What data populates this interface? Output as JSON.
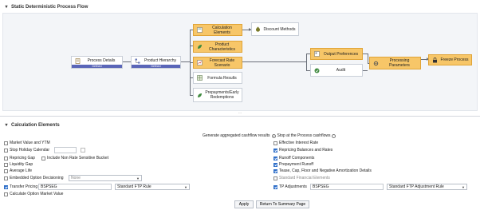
{
  "flow_section": {
    "title": "Static Deterministic Process Flow",
    "nodes": {
      "process_details": {
        "label": "Process Details",
        "status": "Defined"
      },
      "product_hierarchy": {
        "label": "Product Hierarchy",
        "status": "Defined"
      },
      "calculation_elements": {
        "label": "Calculation Elements"
      },
      "discount_methods": {
        "label": "Discount Methods"
      },
      "product_characteristics": {
        "label": "Product Characteristics"
      },
      "forecast_rate_scenario": {
        "label": "Forecast Rate Scenario"
      },
      "formula_results": {
        "label": "Formula Results"
      },
      "prepayments": {
        "label": "Prepayments/Early Redemptions"
      },
      "output_preferences": {
        "label": "Output Preferences"
      },
      "audit": {
        "label": "Audit"
      },
      "processing_parameters": {
        "label": "Processing Parameters"
      },
      "freeze_process": {
        "label": "Freeze Process"
      }
    }
  },
  "calc_section": {
    "title": "Calculation Elements",
    "cashflow_label": "Generate aggregated cashflow results",
    "stop_at_flows": "Stop at the Process cashflows",
    "left": {
      "market_value": "Market Value and YTM",
      "stop_holiday": "Stop Holiday Calendar",
      "repricing_gap": "Repricing Gap",
      "non_rate": "Include Non Rate Sensitive Bucket",
      "liquidity_gap": "Liquidity Gap",
      "average_life": "Average Life",
      "embedded_option": "Embedded Option Decisioning",
      "embedded_value": "None",
      "transfer_pricing": "Transfer Pricing",
      "tp_code": "BSPSEG",
      "tp_rule": "Standard FTP Rule",
      "calc_option": "Calculate Option Market Value"
    },
    "right": {
      "effective_rate": "Effective Interest Rate",
      "repricing_balances": "Repricing Balances and Rates",
      "runoff": "Runoff Components",
      "prepayment_runoff": "Prepayment Runoff",
      "tease_cap": "Tease, Cap, Floor and Negative Amortization Details",
      "standard_financial": "Standard Financial Elements",
      "tp_adjustments": "TP Adjustments",
      "tp_adj_code": "BSPSEG",
      "tp_adj_rule": "Standard FTP Adjustment Rule"
    },
    "buttons": {
      "apply": "Apply",
      "return": "Return To Summary Page"
    }
  }
}
